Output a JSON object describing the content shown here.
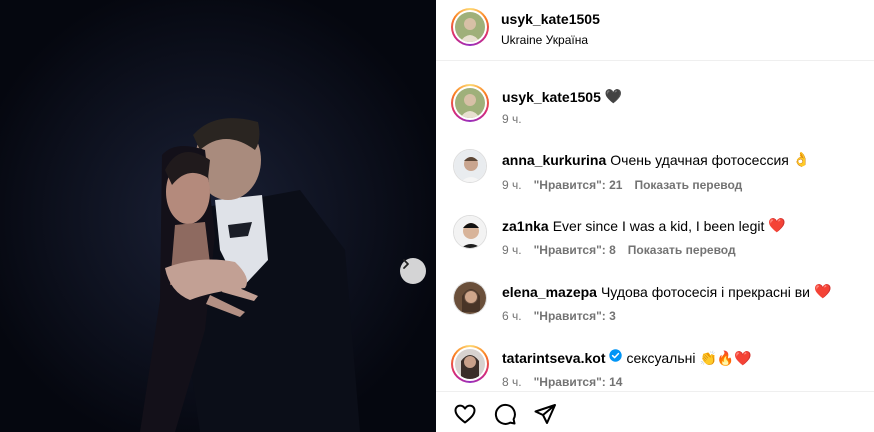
{
  "post": {
    "author": "usyk_kate1505",
    "location": "Ukraine Україна",
    "caption_emoji": "🖤",
    "caption_time": "9 ч."
  },
  "comments": [
    {
      "user": "anna_kurkurina",
      "text": "Очень удачная фотосессия",
      "emoji": "👌",
      "time": "9 ч.",
      "likes": "\"Нравится\": 21",
      "translate": "Показать перевод"
    },
    {
      "user": "za1nka",
      "text": "Ever since I was a kid, I been legit",
      "emoji": "❤️",
      "time": "9 ч.",
      "likes": "\"Нравится\": 8",
      "translate": "Показать перевод"
    },
    {
      "user": "elena_mazepa",
      "text": "Чудова фотосесія і прекрасні ви",
      "emoji": "❤️",
      "time": "6 ч.",
      "likes": "\"Нравится\": 3"
    },
    {
      "user": "tatarintseva.kot",
      "verified": true,
      "text": "сексуальні",
      "emoji": "👏🔥❤️",
      "time": "8 ч.",
      "likes": "\"Нравится\": 14"
    }
  ],
  "icons": {
    "like": "heart-icon",
    "comment": "comment-icon",
    "share": "share-icon",
    "next": "chevron-right-icon",
    "verified": "verified-badge-icon"
  },
  "colors": {
    "photo_bg": "#070a14",
    "verified": "#0095f6",
    "meta_text": "#737373"
  }
}
